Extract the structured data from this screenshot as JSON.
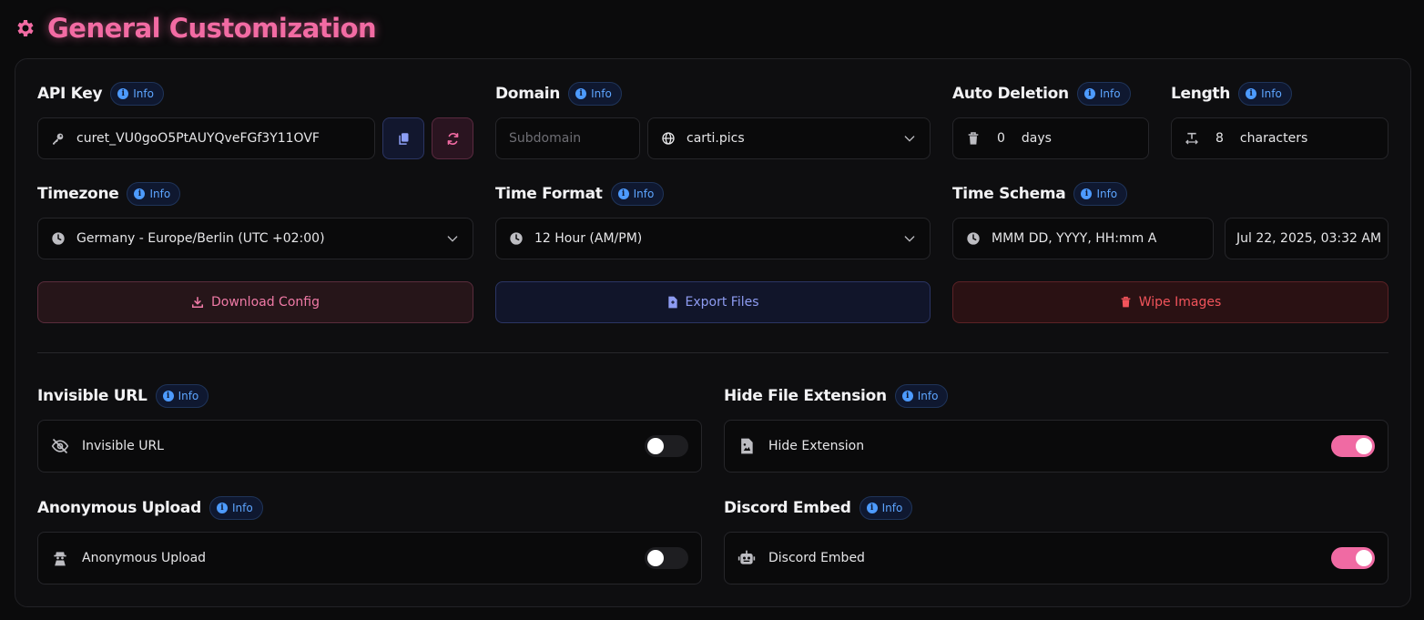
{
  "header": {
    "title": "General Customization",
    "accent": "#f26ba3"
  },
  "info_label": "Info",
  "api_key": {
    "label": "API Key",
    "value": "curet_VU0goO5PtAUYQveFGf3Y11OVF"
  },
  "domain": {
    "label": "Domain",
    "subdomain_placeholder": "Subdomain",
    "selected": "carti.pics"
  },
  "auto_deletion": {
    "label": "Auto Deletion",
    "value": "0",
    "unit": "days"
  },
  "length": {
    "label": "Length",
    "value": "8",
    "unit": "characters"
  },
  "timezone": {
    "label": "Timezone",
    "selected": "Germany - Europe/Berlin (UTC +02:00)"
  },
  "time_format": {
    "label": "Time Format",
    "selected": "12 Hour (AM/PM)"
  },
  "time_schema": {
    "label": "Time Schema",
    "value": "MMM DD, YYYY, HH:mm A",
    "preview": "Jul 22, 2025, 03:32 AM"
  },
  "actions": {
    "download": "Download Config",
    "export": "Export Files",
    "wipe": "Wipe Images"
  },
  "toggles": {
    "invisible_url": {
      "label": "Invisible URL",
      "option": "Invisible URL",
      "enabled": false
    },
    "hide_extension": {
      "label": "Hide File Extension",
      "option": "Hide Extension",
      "enabled": true
    },
    "anonymous_upload": {
      "label": "Anonymous Upload",
      "option": "Anonymous Upload",
      "enabled": false
    },
    "discord_embed": {
      "label": "Discord Embed",
      "option": "Discord Embed",
      "enabled": true
    }
  }
}
